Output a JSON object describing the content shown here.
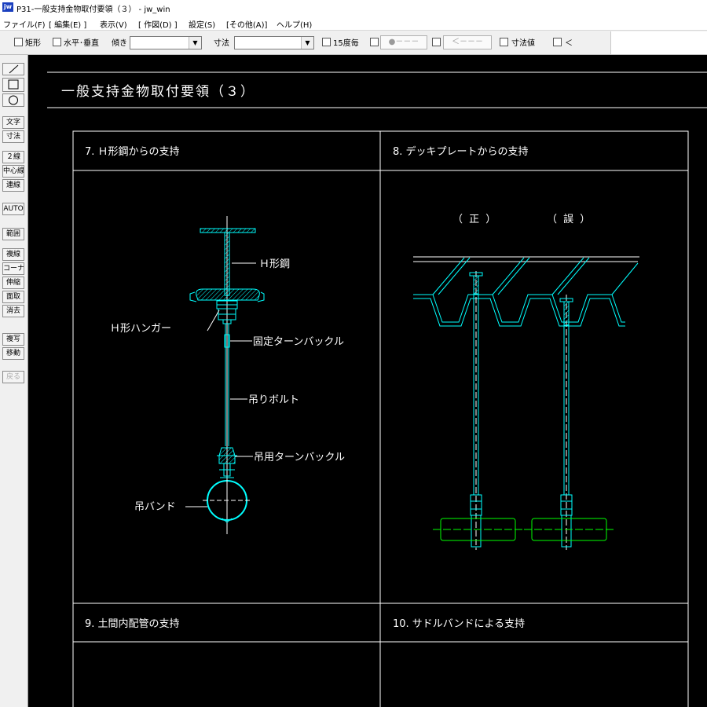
{
  "window": {
    "title": "P31-一般支持金物取付要領（３） - jw_win",
    "app_icon": "jw"
  },
  "menu": [
    "ファイル(F)",
    "[ 編集(E) ]",
    "表示(V)",
    "[ 作図(D) ]",
    "設定(S)",
    "[その他(A)]",
    "ヘルプ(H)"
  ],
  "toolbar": {
    "rect_label": "矩形",
    "horizontal_label": "水平･垂直",
    "tilt_label": "傾き",
    "dimension_label": "寸法",
    "every15_label": "15度毎",
    "button1_label": "●－－－",
    "button2_label": "＜－－－",
    "dimvalue_label": "寸法値",
    "last_label": "＜"
  },
  "sidebar": [
    "文字",
    "寸法",
    "２線",
    "中心線",
    "連線",
    "AUTO",
    "範囲",
    "複線",
    "コーナー",
    "伸縮",
    "面取",
    "消去",
    "複写",
    "移動",
    "戻る"
  ],
  "drawing": {
    "page_title": "一般支持金物取付要領（３）",
    "panel7_title": "7. Ｈ形鋼からの支持",
    "panel8_title": "8. デッキプレートからの支持",
    "panel9_title": "9. 土間内配管の支持",
    "panel10_title": "10. サドルバンドによる支持",
    "label_h_beam": "Ｈ形鋼",
    "label_h_hanger": "Ｈ形ハンガー",
    "label_fixed_turnbuckle": "固定ターンバックル",
    "label_hanger_bolt": "吊りボルト",
    "label_hanging_turnbuckle": "吊用ターンバックル",
    "label_hanging_band": "吊バンド",
    "label_correct": "（ 正 ）",
    "label_wrong": "（ 誤 ）"
  },
  "colors": {
    "line_white": "#ffffff",
    "line_cyan": "#00ffff",
    "line_green": "#00ff00",
    "canvas_bg": "#000000"
  }
}
